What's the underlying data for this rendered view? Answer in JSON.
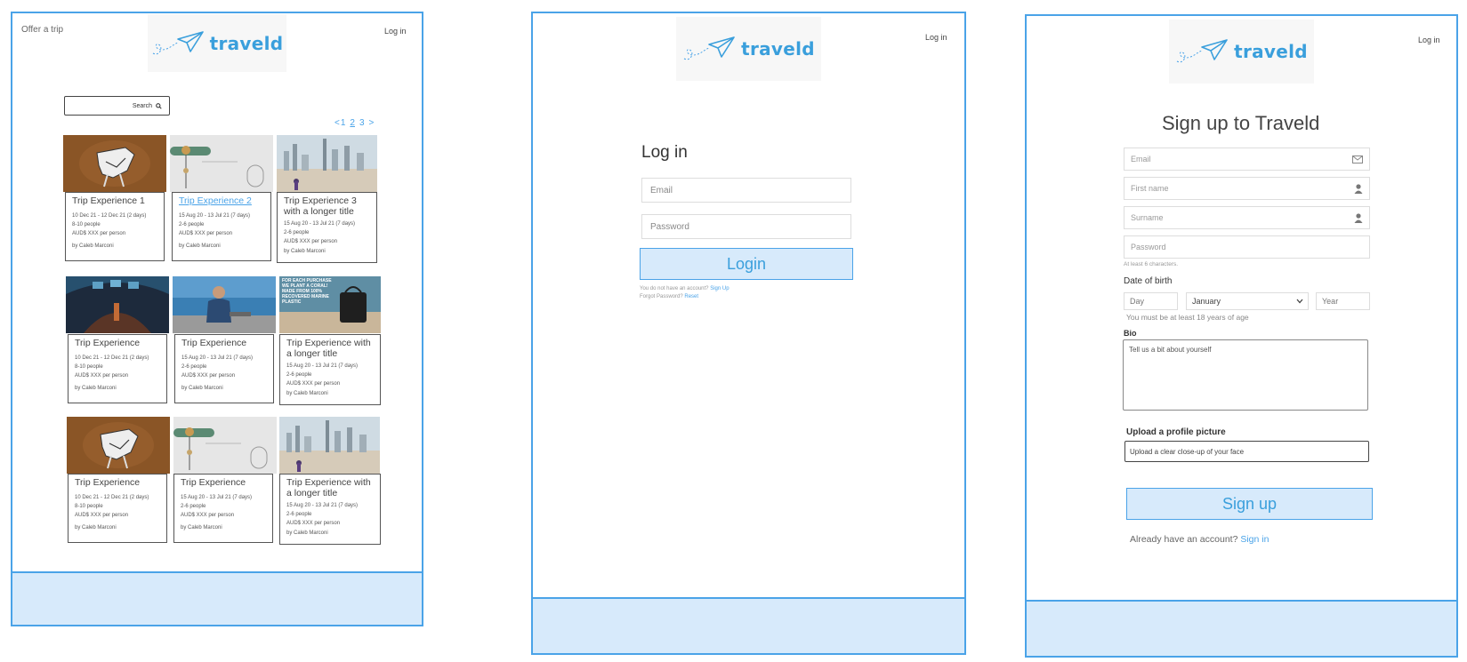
{
  "brand": {
    "name": "traveld",
    "color": "#3a9fdc",
    "accent": "#4aa3e8",
    "footer_bg": "#d7eafb"
  },
  "frame1": {
    "offer_link": "Offer a trip",
    "login_link": "Log in",
    "search_label": "Search",
    "pagination": {
      "prev": "<",
      "pages": [
        "1",
        "2",
        "3"
      ],
      "current": "2",
      "next": ">"
    },
    "cards": [
      {
        "title": "Trip Experience 1",
        "active": false,
        "dates": "10 Dec 21 - 12 Dec 21 (2 days)",
        "people": "8-10 people",
        "price": "AUD$ XXX per person",
        "by": "by Caleb Marconi",
        "image": "cow-sculpture"
      },
      {
        "title": "Trip Experience 2",
        "active": true,
        "dates": "15 Aug 20 - 13 Jul 21 (7 days)",
        "people": "2-6 people",
        "price": "AUD$ XXX per person",
        "by": "by Caleb Marconi",
        "image": "pin-wallpaper"
      },
      {
        "title": "Trip Experience 3 with a longer title",
        "active": false,
        "dates": "15 Aug 20 - 13 Jul 21 (7 days)",
        "people": "2-6 people",
        "price": "AUD$ XXX per person",
        "by": "by Caleb Marconi",
        "image": "city-skyline"
      },
      {
        "title": "Trip Experience",
        "active": false,
        "dates": "10 Dec 21 - 12 Dec 21 (2 days)",
        "people": "8-10 people",
        "price": "AUD$ XXX per person",
        "by": "by Caleb Marconi",
        "image": "aquarium-tunnel"
      },
      {
        "title": "Trip Experience",
        "active": false,
        "dates": "15 Aug 20 - 13 Jul 21 (7 days)",
        "people": "2-6 people",
        "price": "AUD$ XXX per person",
        "by": "by Caleb Marconi",
        "image": "chef-cooking"
      },
      {
        "title": "Trip Experience with a longer title",
        "active": false,
        "dates": "15 Aug 20 - 13 Jul 21 (7 days)",
        "people": "2-6 people",
        "price": "AUD$ XXX per person",
        "by": "by Caleb Marconi",
        "image": "coral-bag-ad",
        "ad_text": "FOR EACH PURCHASE WE PLANT A CORAL! MADE FROM 100% RECOVERED MARINE PLASTIC"
      },
      {
        "title": "Trip Experience",
        "active": false,
        "dates": "10 Dec 21 - 12 Dec 21 (2 days)",
        "people": "8-10 people",
        "price": "AUD$ XXX per person",
        "by": "by Caleb Marconi",
        "image": "cow-sculpture"
      },
      {
        "title": "Trip Experience",
        "active": false,
        "dates": "15 Aug 20 - 13 Jul 21 (7 days)",
        "people": "2-6 people",
        "price": "AUD$ XXX per person",
        "by": "by Caleb Marconi",
        "image": "pin-wallpaper"
      },
      {
        "title": "Trip Experience  with a longer title",
        "active": false,
        "dates": "15 Aug 20 - 13 Jul 21 (7 days)",
        "people": "2-6 people",
        "price": "AUD$ XXX per person",
        "by": "by Caleb Marconi",
        "image": "city-skyline"
      }
    ]
  },
  "frame2": {
    "login_link": "Log in",
    "heading": "Log in",
    "email_placeholder": "Email",
    "password_placeholder": "Password",
    "login_button": "Login",
    "no_account_text": "You do not have an account?",
    "signup_link": "Sign Up",
    "forgot_text": "Forgot Password?",
    "reset_link": "Reset"
  },
  "frame3": {
    "login_link": "Log in",
    "heading": "Sign up to Traveld",
    "email_placeholder": "Email",
    "first_name_placeholder": "First name",
    "surname_placeholder": "Surname",
    "password_placeholder": "Password",
    "password_hint": "At least 6 characters.",
    "dob_label": "Date of birth",
    "day_placeholder": "Day",
    "month_value": "January",
    "year_placeholder": "Year",
    "age_hint": "You must be at least 18 years of age",
    "bio_label": "Bio",
    "bio_placeholder": "Tell us a bit about yourself",
    "upload_label": "Upload a profile picture",
    "upload_placeholder": "Upload a clear close-up of your face",
    "signup_button": "Sign up",
    "already_text": "Already have an account?",
    "signin_link": "Sign in"
  }
}
